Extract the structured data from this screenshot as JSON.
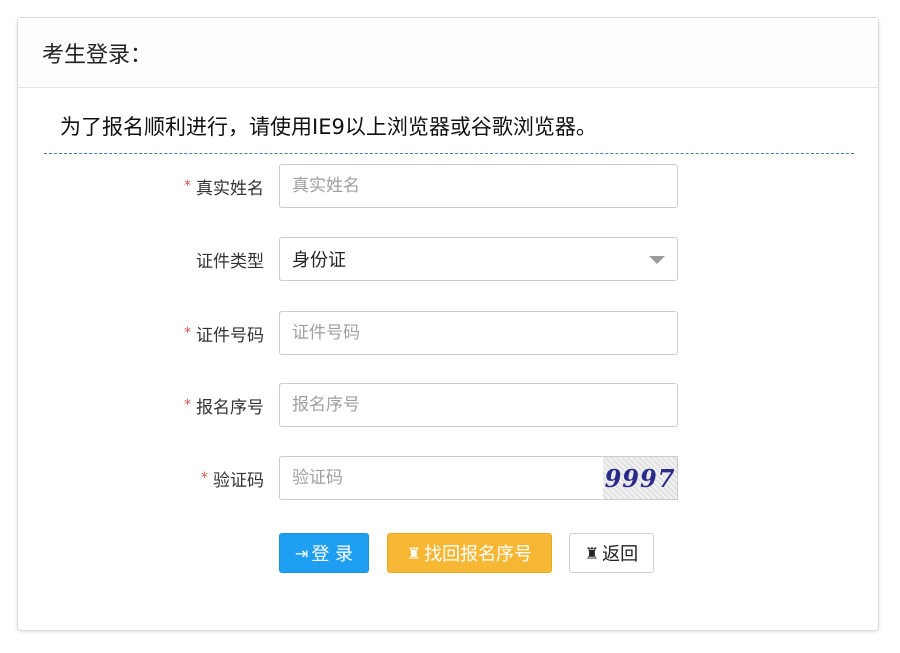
{
  "panel": {
    "title": "考生登录："
  },
  "notice": "为了报名顺利进行，请使用IE9以上浏览器或谷歌浏览器。",
  "form": {
    "real_name": {
      "label": "真实姓名",
      "required_mark": "*",
      "placeholder": "真实姓名",
      "value": ""
    },
    "id_type": {
      "label": "证件类型",
      "selected": "身份证"
    },
    "id_number": {
      "label": "证件号码",
      "required_mark": "*",
      "placeholder": "证件号码",
      "value": ""
    },
    "reg_number": {
      "label": "报名序号",
      "required_mark": "*",
      "placeholder": "报名序号",
      "value": ""
    },
    "captcha": {
      "label": "验证码",
      "required_mark": "*",
      "placeholder": "验证码",
      "value": "",
      "image_text": "9997"
    }
  },
  "buttons": {
    "login": {
      "icon": "⇥",
      "label": "登 录"
    },
    "find": {
      "icon": "♜",
      "label": "找回报名序号"
    },
    "back": {
      "icon": "♜",
      "label": "返回"
    }
  },
  "colors": {
    "login_bg": "#1e9ff2",
    "find_bg": "#f6b734",
    "required": "#d9534f",
    "notice_border": "#4a7ba7"
  }
}
